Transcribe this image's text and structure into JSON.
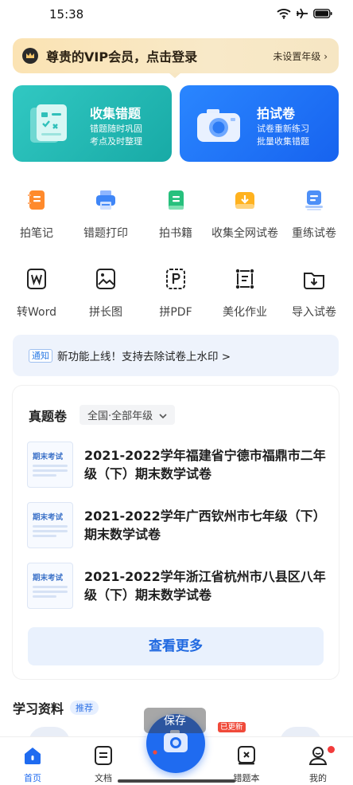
{
  "status_bar": {
    "time": "15:38"
  },
  "vip_banner": {
    "title": "尊贵的VIP会员，点击登录",
    "grade_link": "未设置年级",
    "chevron": "›"
  },
  "feature_cards": [
    {
      "title": "收集错题",
      "subtitle": "错题随时巩固\n考点及时整理",
      "color": "#22b8b3"
    },
    {
      "title": "拍试卷",
      "subtitle": "试卷重新练习\n批量收集错题",
      "color": "#1f6ef5"
    }
  ],
  "tools_row1": [
    {
      "label": "拍笔记",
      "icon": "notebook-icon"
    },
    {
      "label": "错题打印",
      "icon": "printer-icon"
    },
    {
      "label": "拍书籍",
      "icon": "book-icon"
    },
    {
      "label": "收集全网试卷",
      "icon": "download-tray-icon"
    },
    {
      "label": "重练试卷",
      "icon": "stack-icon"
    }
  ],
  "tools_row2": [
    {
      "label": "转Word",
      "icon": "word-icon"
    },
    {
      "label": "拼长图",
      "icon": "image-icon"
    },
    {
      "label": "拼PDF",
      "icon": "pdf-icon"
    },
    {
      "label": "美化作业",
      "icon": "crop-icon"
    },
    {
      "label": "导入试卷",
      "icon": "folder-import-icon"
    }
  ],
  "notice": {
    "tag": "通知",
    "text": "新功能上线！支持去除试卷上水印 >"
  },
  "real_exams": {
    "title": "真题卷",
    "filter": "全国·全部年级",
    "thumb_label": "期末考试",
    "items": [
      {
        "title": "2021-2022学年福建省宁德市福鼎市二年级（下）期末数学试卷"
      },
      {
        "title": "2021-2022学年广西钦州市七年级（下）期末数学试卷"
      },
      {
        "title": "2021-2022学年浙江省杭州市八县区八年级（下）期末数学试卷"
      }
    ],
    "more_button": "查看更多"
  },
  "study": {
    "title": "学习资料",
    "badge": "推荐"
  },
  "tabbar": {
    "tabs": [
      {
        "label": "首页",
        "icon": "home-icon",
        "active": true
      },
      {
        "label": "文档",
        "icon": "document-icon",
        "active": false
      },
      {
        "label": "错题本",
        "icon": "mistake-book-icon",
        "active": false
      },
      {
        "label": "我的",
        "icon": "profile-icon",
        "active": false
      }
    ],
    "camera_tip": "保存",
    "new_badge": "已更新"
  },
  "colors": {
    "accent": "#1f6bf0",
    "teal": "#22b8b3",
    "vip": "#f8e4b8"
  }
}
